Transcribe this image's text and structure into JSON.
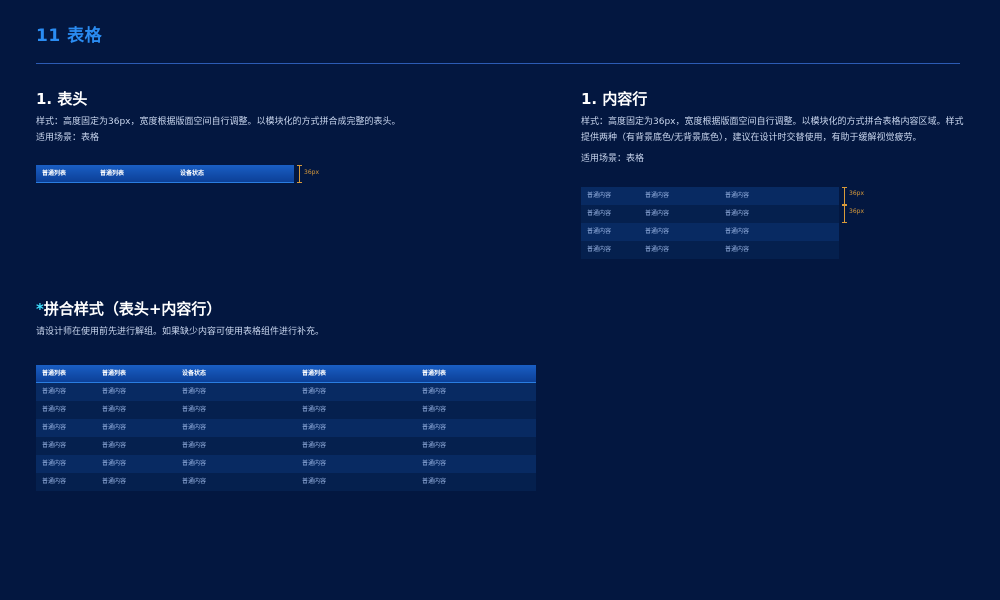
{
  "header": {
    "title": "11 表格"
  },
  "section_header": {
    "title": "1. 表头",
    "desc": "样式：高度固定为36px，宽度根据版面空间自行调整。以模块化的方式拼合成完整的表头。",
    "usage": "适用场景：表格",
    "columns": [
      "普通列表",
      "普通列表",
      "设备状态"
    ],
    "dim_label": "36px"
  },
  "section_rows": {
    "title": "1. 内容行",
    "desc_line1": "样式：高度固定为36px，宽度根据版面空间自行调整。以模块化的方式拼合表格内容区域。样式",
    "desc_line2": "提供两种（有背景底色/无背景底色），建议在设计时交替使用，有助于缓解视觉疲劳。",
    "usage": "适用场景：表格",
    "rows": [
      [
        "普通内容",
        "普通内容",
        "普通内容"
      ],
      [
        "普通内容",
        "普通内容",
        "普通内容"
      ],
      [
        "普通内容",
        "普通内容",
        "普通内容"
      ],
      [
        "普通内容",
        "普通内容",
        "普通内容"
      ]
    ],
    "dim_label_1": "36px",
    "dim_label_2": "36px"
  },
  "section_combined": {
    "star": "*",
    "title": "拼合样式（表头+内容行）",
    "desc": "请设计师在使用前先进行解组。如果缺少内容可使用表格组件进行补充。",
    "columns": [
      "普通列表",
      "普通列表",
      "设备状态",
      "普通列表",
      "普通列表"
    ],
    "rows": [
      [
        "普通内容",
        "普通内容",
        "普通内容",
        "普通内容",
        "普通内容"
      ],
      [
        "普通内容",
        "普通内容",
        "普通内容",
        "普通内容",
        "普通内容"
      ],
      [
        "普通内容",
        "普通内容",
        "普通内容",
        "普通内容",
        "普通内容"
      ],
      [
        "普通内容",
        "普通内容",
        "普通内容",
        "普通内容",
        "普通内容"
      ],
      [
        "普通内容",
        "普通内容",
        "普通内容",
        "普通内容",
        "普通内容"
      ],
      [
        "普通内容",
        "普通内容",
        "普通内容",
        "普通内容",
        "普通内容"
      ]
    ]
  },
  "colors": {
    "background": "#031740",
    "accent_blue": "#2a8cf2",
    "header_row": "#1a5fc4",
    "row_filled": "#082a62",
    "row_plain": "#05204e",
    "dimension": "#d89a3a"
  }
}
